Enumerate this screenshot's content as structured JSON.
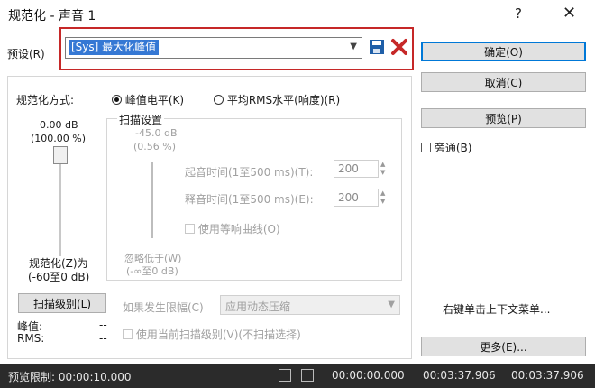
{
  "window": {
    "title": "规范化 - 声音 1",
    "help_label": "?",
    "close_label": "✕"
  },
  "preset": {
    "label": "预设(R)",
    "selected": "[Sys] 最大化峰值"
  },
  "actions": {
    "ok": "确定(O)",
    "cancel": "取消(C)",
    "preview": "预览(P)",
    "bypass": "旁通(B)",
    "context_hint": "右键单击上下文菜单...",
    "more": "更多(E)..."
  },
  "normalize": {
    "method_label": "规范化方式:",
    "peak_option": "峰值电平(K)",
    "rms_option": "平均RMS水平(响度)(R)",
    "peak_db": "0.00 dB",
    "peak_percent": "(100.00 %)",
    "level_label": "规范化(Z)为",
    "level_range": "(-60至0 dB)",
    "scan_button": "扫描级别(L)",
    "peak_value_label": "峰值:",
    "peak_value": "--",
    "rms_label": "RMS:",
    "rms_value": "--"
  },
  "scan": {
    "title": "扫描设置",
    "db_value": "-45.0 dB",
    "percent_value": "(0.56 %)",
    "attack_label": "起音时间(1至500 ms)(T):",
    "attack_value": "200",
    "release_label": "释音时间(1至500 ms)(E):",
    "release_value": "200",
    "equal_loudness_label": "使用等响曲线(O)",
    "ignore_label": "忽略低于(W)",
    "ignore_range": "(-∞至0 dB)"
  },
  "limit": {
    "label": "如果发生限幅(C)",
    "value": "应用动态压缩",
    "use_current_scan": "使用当前扫描级别(V)(不扫描选择)"
  },
  "status": {
    "preview_limit": "预览限制: 00:00:10.000",
    "time1": "00:00:00.000",
    "time2": "00:03:37.906",
    "time3": "00:03:37.906"
  },
  "colors": {
    "highlight": "#3578d4",
    "red_frame": "#c62828",
    "save_icon": "#1f5fa8",
    "delete_icon": "#c62828"
  }
}
